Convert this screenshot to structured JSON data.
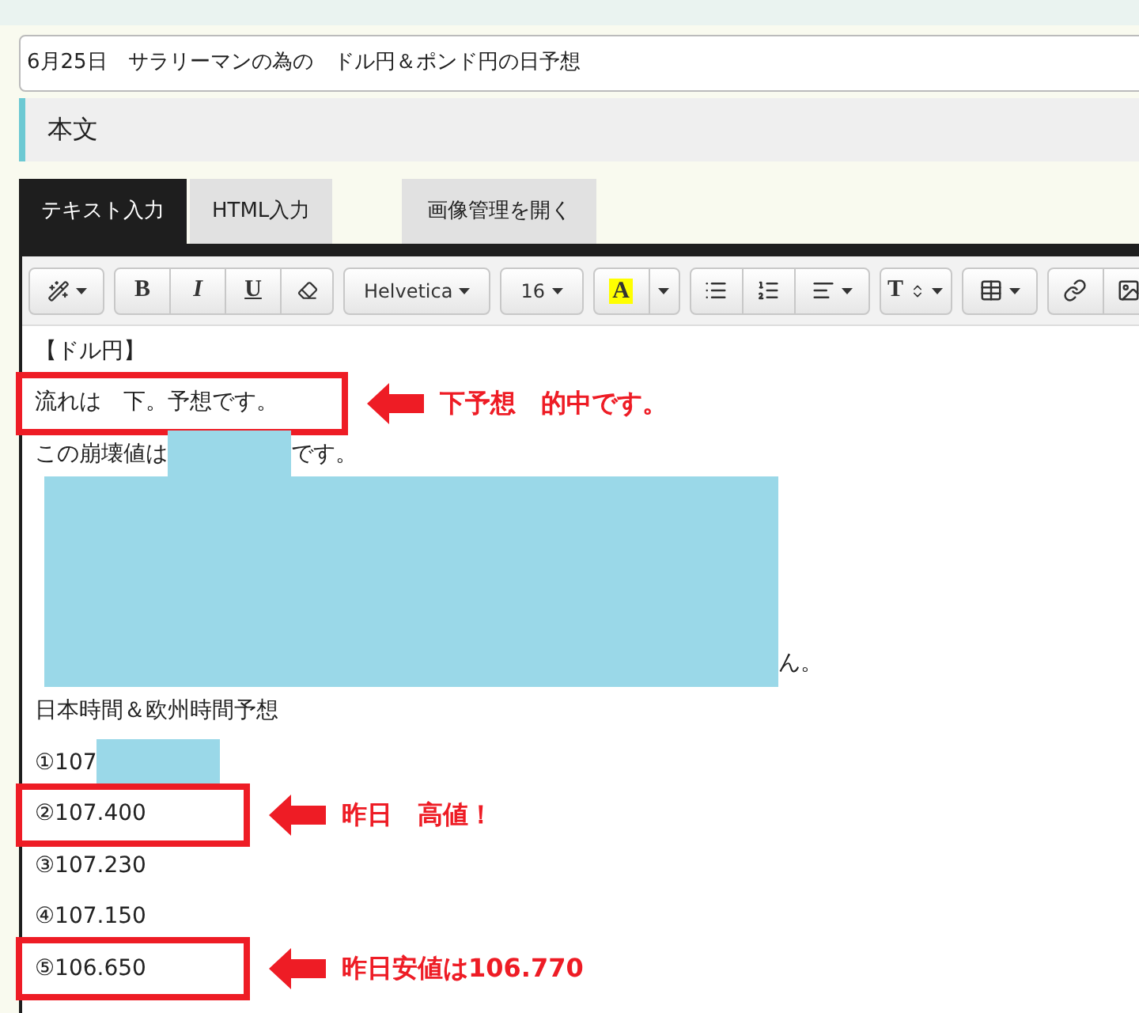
{
  "title_field": {
    "value": "6月25日　サラリーマンの為の　ドル円＆ポンド円の日予想"
  },
  "section_heading": "本文",
  "tabs": [
    {
      "label": "テキスト入力",
      "selected": true
    },
    {
      "label": "HTML入力",
      "selected": false
    }
  ],
  "image_manager_button": "画像管理を開く",
  "toolbar": [
    [
      {
        "kind": "wand"
      }
    ],
    [
      {
        "kind": "bold",
        "label": "B"
      },
      {
        "kind": "italic",
        "label": "I"
      },
      {
        "kind": "underline",
        "label": "U"
      },
      {
        "kind": "eraser"
      }
    ],
    [
      {
        "kind": "dropdown",
        "label": "Helvetica"
      }
    ],
    [
      {
        "kind": "dropdown",
        "label": "16"
      }
    ],
    [
      {
        "kind": "color",
        "label": "A"
      },
      {
        "kind": "caret"
      }
    ],
    [
      {
        "kind": "ul"
      },
      {
        "kind": "ol"
      },
      {
        "kind": "align"
      }
    ],
    [
      {
        "kind": "textsize",
        "label": "T"
      }
    ],
    [
      {
        "kind": "table"
      }
    ],
    [
      {
        "kind": "link"
      },
      {
        "kind": "image"
      }
    ]
  ],
  "lines": [
    {
      "kind": "text",
      "text": "【ドル円】",
      "highlighted": false
    },
    {
      "kind": "text",
      "text": "流れは　下。予想です。",
      "highlighted": true,
      "note": "下予想　的中です。"
    },
    {
      "kind": "text",
      "text": "この崩壊値は",
      "redacted": true,
      "after": "です。",
      "highlighted": false
    },
    {
      "kind": "redacted_block",
      "tail": "ん。"
    },
    {
      "kind": "text",
      "text": "日本時間＆欧州時間予想",
      "highlighted": false
    },
    {
      "kind": "text",
      "text": "①107",
      "redacted": true,
      "highlighted": false
    },
    {
      "kind": "text",
      "text": "②107.400",
      "highlighted": true,
      "note": "昨日　高値！"
    },
    {
      "kind": "text",
      "text": "③107.230",
      "highlighted": false
    },
    {
      "kind": "text",
      "text": "④107.150",
      "highlighted": false
    },
    {
      "kind": "text",
      "text": "⑤106.650",
      "highlighted": true,
      "note": "昨日安値は106.770"
    }
  ]
}
